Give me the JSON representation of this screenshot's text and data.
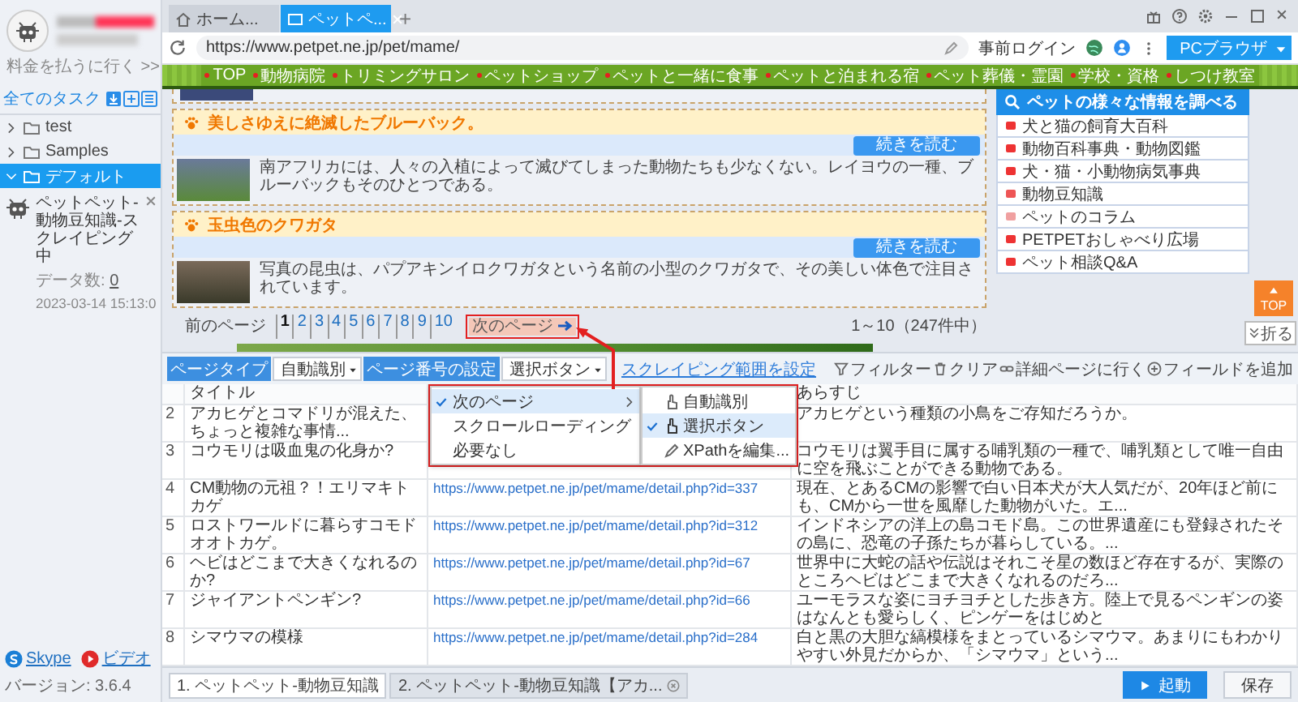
{
  "account": {
    "pay_link": "料金を払うに行く >>"
  },
  "task_panel": {
    "title": "全てのタスク",
    "folders": [
      {
        "name": "test",
        "expanded": false,
        "selected": false
      },
      {
        "name": "Samples",
        "expanded": false,
        "selected": false
      },
      {
        "name": "デフォルト",
        "expanded": true,
        "selected": true,
        "tasks": [
          {
            "name": "ペットペット-動物豆知識-スクレイピング中",
            "count_label": "データ数:",
            "count": "0",
            "time": "2023-03-14 15:13:0"
          }
        ]
      }
    ]
  },
  "footer": {
    "links": [
      {
        "kind": "skype",
        "label": "Skype"
      },
      {
        "kind": "video",
        "label": "ビデオ"
      }
    ],
    "version": "バージョン: 3.6.4"
  },
  "browser": {
    "tabs": [
      {
        "kind": "home",
        "title": "ホーム...",
        "selected": false
      },
      {
        "kind": "page",
        "title": "ペットペ...",
        "selected": true
      }
    ],
    "new_tab": "+",
    "url": "https://www.petpet.ne.jp/pet/mame/",
    "login": "事前ログイン",
    "mode": "PCブラウザ"
  },
  "page": {
    "nav": [
      "TOP",
      "動物病院",
      "トリミングサロン",
      "ペットショップ",
      "ペットと一緒に食事",
      "ペットと泊まれる宿",
      "ペット葬儀・霊園",
      "学校・資格",
      "しつけ教室"
    ],
    "articles": [
      {
        "title": "美しさゆえに絶滅したブルーバック。",
        "button": "続きを読む",
        "text": "南アフリカには、人々の入植によって滅びてしまった動物たちも少なくない。レイヨウの一種、ブルーバックもそのひとつである。"
      },
      {
        "title": "玉虫色のクワガタ",
        "button": "続きを読む",
        "text": "写真の昆虫は、パプアキンイロクワガタという名前の小型のクワガタで、その美しい体色で注目されています。"
      }
    ],
    "info_box": {
      "title": "ペットの様々な情報を調べる",
      "items": [
        "犬と猫の飼育大百科",
        "動物百科事典・動物図鑑",
        "犬・猫・小動物病気事典",
        "動物豆知識",
        "ペットのコラム",
        "PETPETおしゃべり広場",
        "ペット相談Q&A"
      ]
    },
    "pagination": {
      "prev": "前のページ",
      "pages": [
        {
          "label": "1",
          "selected": true
        },
        {
          "label": "2",
          "selected": false
        },
        {
          "label": "3",
          "selected": false
        },
        {
          "label": "4",
          "selected": false
        },
        {
          "label": "5",
          "selected": false
        },
        {
          "label": "6",
          "selected": false
        },
        {
          "label": "7",
          "selected": false
        },
        {
          "label": "8",
          "selected": false
        },
        {
          "label": "9",
          "selected": false
        },
        {
          "label": "10",
          "selected": false
        }
      ],
      "next": "次のページ",
      "count": "1～10（247件中）"
    },
    "top_button": "TOP",
    "fold_button": "折る"
  },
  "toolbar": {
    "page_type_label": "ページタイプ",
    "page_type": "自動識別",
    "paging_label": "ページ番号の設定",
    "paging": "選択ボタン",
    "range_link": "スクレイピング範囲を設定",
    "actions": [
      {
        "kind": "filter",
        "label": "フィルター"
      },
      {
        "kind": "clear",
        "label": "クリア"
      },
      {
        "kind": "detail",
        "label": "詳細ページに行く"
      },
      {
        "kind": "add",
        "label": "フィールドを追加"
      }
    ]
  },
  "paging_menu": {
    "items": [
      {
        "label": "次のページ",
        "checked": true,
        "has_submenu": true
      },
      {
        "label": "スクロールローディング",
        "checked": false,
        "has_submenu": false
      },
      {
        "label": "必要なし",
        "checked": false,
        "has_submenu": false
      }
    ],
    "submenu": [
      {
        "kind": "auto",
        "label": "自動識別",
        "checked": false
      },
      {
        "kind": "click",
        "label": "選択ボタン",
        "checked": true
      },
      {
        "kind": "xpath",
        "label": "XPathを編集...",
        "checked": false
      }
    ]
  },
  "table": {
    "columns": {
      "title": "タイトル",
      "synopsis": "あらすじ"
    },
    "rows": [
      {
        "index": "2",
        "title": "アカヒゲとコマドリが混えた、ちょっと複雑な事情...",
        "synopsis": "アカヒゲという種類の小鳥をご存知だろうか。"
      },
      {
        "index": "3",
        "title": "コウモリは吸血鬼の化身か?",
        "synopsis": "コウモリは翼手目に属する哺乳類の一種で、哺乳類として唯一自由に空を飛ぶことができる動物である。"
      },
      {
        "index": "4",
        "title": "CM動物の元祖？！エリマキトカゲ",
        "url": "https://www.petpet.ne.jp/pet/mame/detail.php?id=337",
        "synopsis": "現在、とあるCMの影響で白い日本犬が大人気だが、20年ほど前にも、CMから一世を風靡した動物がいた。エ..."
      },
      {
        "index": "5",
        "title": "ロストワールドに暮らすコモドオオトカゲ。",
        "url": "https://www.petpet.ne.jp/pet/mame/detail.php?id=312",
        "synopsis": "インドネシアの洋上の島コモド島。この世界遺産にも登録されたその島に、恐竜の子孫たちが暮らしている。..."
      },
      {
        "index": "6",
        "title": "ヘビはどこまで大きくなれるのか?",
        "url": "https://www.petpet.ne.jp/pet/mame/detail.php?id=67",
        "synopsis": "世界中に大蛇の話や伝説はそれこそ星の数ほど存在するが、実際のところヘビはどこまで大きくなれるのだろ..."
      },
      {
        "index": "7",
        "title": "ジャイアントペンギン?",
        "url": "https://www.petpet.ne.jp/pet/mame/detail.php?id=66",
        "synopsis": "ユーモラスな姿にヨチヨチとした歩き方。陸上で見るペンギンの姿はなんとも愛らしく、ピンゲーをはじめと"
      },
      {
        "index": "8",
        "title": "シマウマの模様",
        "url": "https://www.petpet.ne.jp/pet/mame/detail.php?id=284",
        "synopsis": "白と黒の大胆な縞模様をまとっているシマウマ。あまりにもわかりやすい外見だからか、「シマウマ」という..."
      }
    ]
  },
  "run_tabs": [
    {
      "label": "1. ペットペット-動物豆知識",
      "selected": true
    },
    {
      "label": "2. ペットペット-動物豆知識【アカ...",
      "selected": false
    }
  ],
  "run_button": "起動",
  "save_button": "保存"
}
